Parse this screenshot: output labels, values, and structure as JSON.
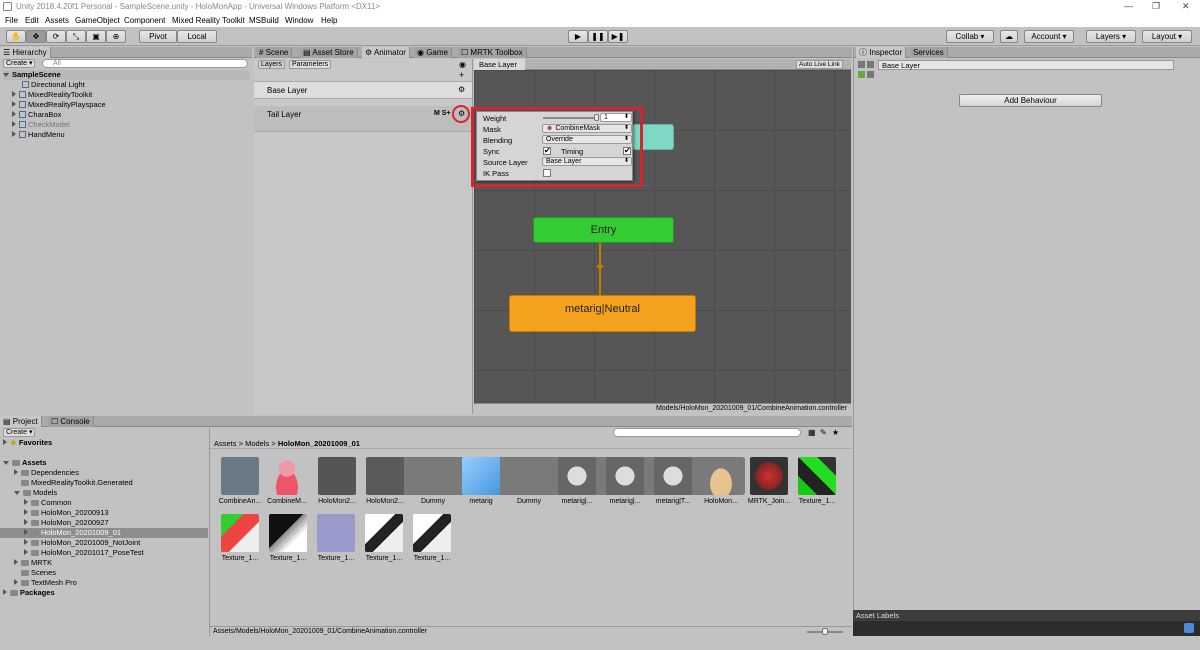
{
  "window": {
    "title": "Unity 2018.4.20f1 Personal - SampleScene.unity - HoloMonApp - Universal Windows Platform <DX11>"
  },
  "menu": [
    "File",
    "Edit",
    "Assets",
    "GameObject",
    "Component",
    "Mixed Reality Toolkit",
    "MSBuild",
    "Window",
    "Help"
  ],
  "toolbar": {
    "pivot": "Pivot",
    "local": "Local",
    "collab": "Collab ▾",
    "account": "Account",
    "layers": "Layers",
    "layout": "Layout"
  },
  "hierarchy": {
    "tab": "Hierarchy",
    "create": "Create",
    "search_placeholder": "All",
    "scene": "SampleScene",
    "items": [
      "Directional Light",
      "MixedRealityToolkit",
      "MixedRealityPlayspace",
      "CharaBox",
      "CheckModel",
      "HandMenu"
    ]
  },
  "center_tabs": [
    "Scene",
    "Asset Store",
    "Animator",
    "Game",
    "MRTK Toolbox"
  ],
  "animator": {
    "subtabs": [
      "Layers",
      "Parameters"
    ],
    "layers": [
      "Base Layer",
      "Tail Layer"
    ],
    "tail_flags": "M S+",
    "breadcrumb": "Base Layer",
    "autolive": "Auto Live Link",
    "path": "Models/HoloMon_20201009_01/CombineAnimation.controller",
    "settings": {
      "weight_label": "Weight",
      "weight_value": "1",
      "weight_fraction": 1,
      "mask_label": "Mask",
      "mask_value": "CombineMask",
      "blending_label": "Blending",
      "blending_value": "Override",
      "sync_label": "Sync",
      "timing_label": "Timing",
      "source_label": "Source Layer",
      "source_value": "Base Layer",
      "ikpass_label": "IK Pass"
    },
    "nodes": {
      "entry": "Entry",
      "neutral": "metarig|Neutral"
    }
  },
  "inspector": {
    "tabs": [
      "Inspector",
      "Services"
    ],
    "name": "Base Layer",
    "add_behaviour": "Add Behaviour",
    "asset_labels": "Asset Labels"
  },
  "project": {
    "tabs": [
      "Project",
      "Console"
    ],
    "create": "Create",
    "favorites": "Favorites",
    "assets": "Assets",
    "tree": [
      "Dependencies",
      "MixedRealityToolkit.Generated",
      "Models",
      "Common",
      "HoloMon_20200913",
      "HoloMon_20200927",
      "HoloMon_20201009_01",
      "HoloMon_20201009_NotJoint",
      "HoloMon_20201017_PoseTest",
      "MRTK",
      "Scenes",
      "TextMesh Pro"
    ],
    "packages": "Packages",
    "breadcrumb": [
      "Assets",
      "Models",
      "HoloMon_20201009_01"
    ],
    "row1": [
      "CombineAn...",
      "CombineM...",
      "HoloMon2...",
      "HoloMon2...",
      "Dummy",
      "metarig",
      "Dummy",
      "metarig|...",
      "metarig|...",
      "metarig|T...",
      "HoloMon...",
      "MRTK_Join...",
      "Texture_1..."
    ],
    "row2": [
      "Texture_1...",
      "Texture_1...",
      "Texture_1...",
      "Texture_1...",
      "Texture_1..."
    ],
    "status_path": "Assets/Models/HoloMon_20201009_01/CombineAnimation.controller"
  },
  "colors": {
    "highlight": "#d7262b",
    "entry": "#33cc33",
    "neutral": "#f5a21f",
    "teal": "#7fd8c6"
  }
}
